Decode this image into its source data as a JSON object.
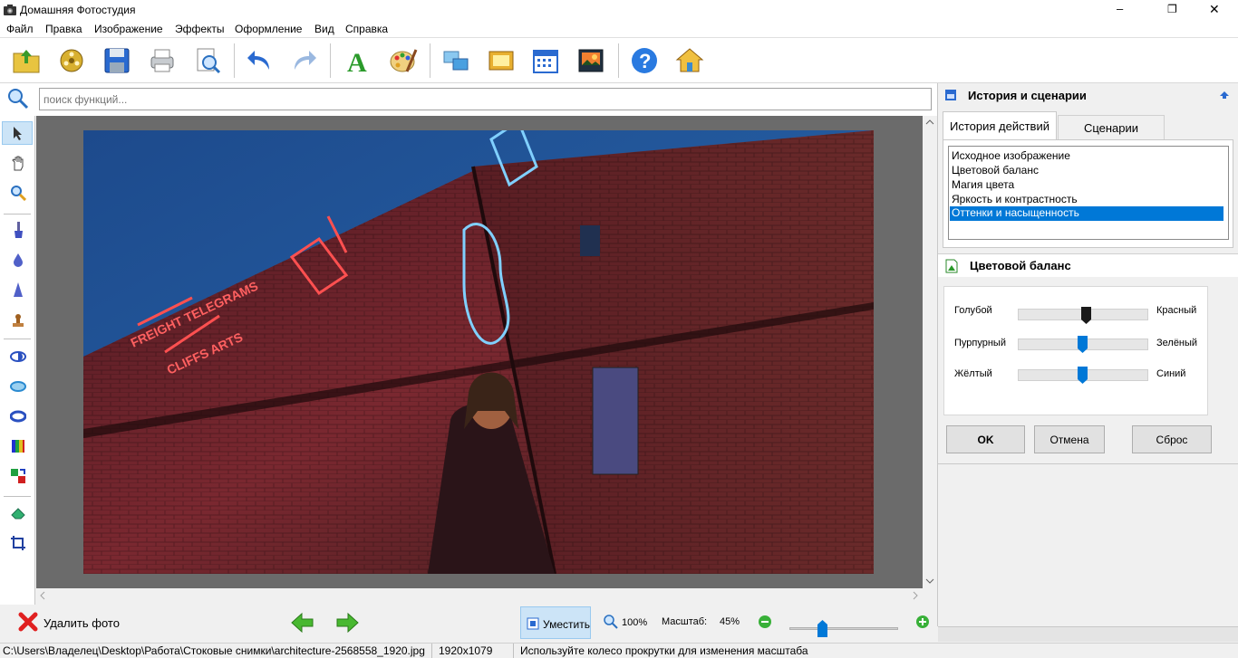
{
  "window": {
    "title": "Домашняя Фотостудия",
    "minimize": "–",
    "maximize": "❐",
    "close": "✕"
  },
  "menu": [
    "Файл",
    "Правка",
    "Изображение",
    "Эффекты",
    "Оформление",
    "Вид",
    "Справка"
  ],
  "search": {
    "placeholder": "поиск функций..."
  },
  "panel": {
    "title": "История и сценарии",
    "tabs": [
      "История действий",
      "Сценарии"
    ],
    "history": [
      "Исходное изображение",
      "Цветовой баланс",
      "Магия цвета",
      "Яркость и контрастность",
      "Оттенки и насыщенность"
    ],
    "selected_index": 4
  },
  "color_balance": {
    "title": "Цветовой баланс",
    "rows": [
      {
        "left": "Голубой",
        "right": "Красный",
        "value": 0.53,
        "active": true
      },
      {
        "left": "Пурпурный",
        "right": "Зелёный",
        "value": 0.5,
        "active": false
      },
      {
        "left": "Жёлтый",
        "right": "Синий",
        "value": 0.5,
        "active": false
      }
    ],
    "ok": "OK",
    "cancel": "Отмена",
    "reset": "Сброс"
  },
  "bottom": {
    "delete_label": "Удалить фото",
    "fit_label": "Уместить",
    "zoom100": "100%",
    "scale_label": "Масштаб:",
    "scale_value": "45%",
    "zoom_slider": 0.3
  },
  "status": {
    "path": "C:\\Users\\Владелец\\Desktop\\Работа\\Стоковые снимки\\architecture-2568558_1920.jpg",
    "dims": "1920x1079",
    "hint": "Используйте колесо прокрутки для изменения масштаба"
  },
  "colors": {
    "selection": "#0078d7",
    "accent": "#0078d7"
  }
}
